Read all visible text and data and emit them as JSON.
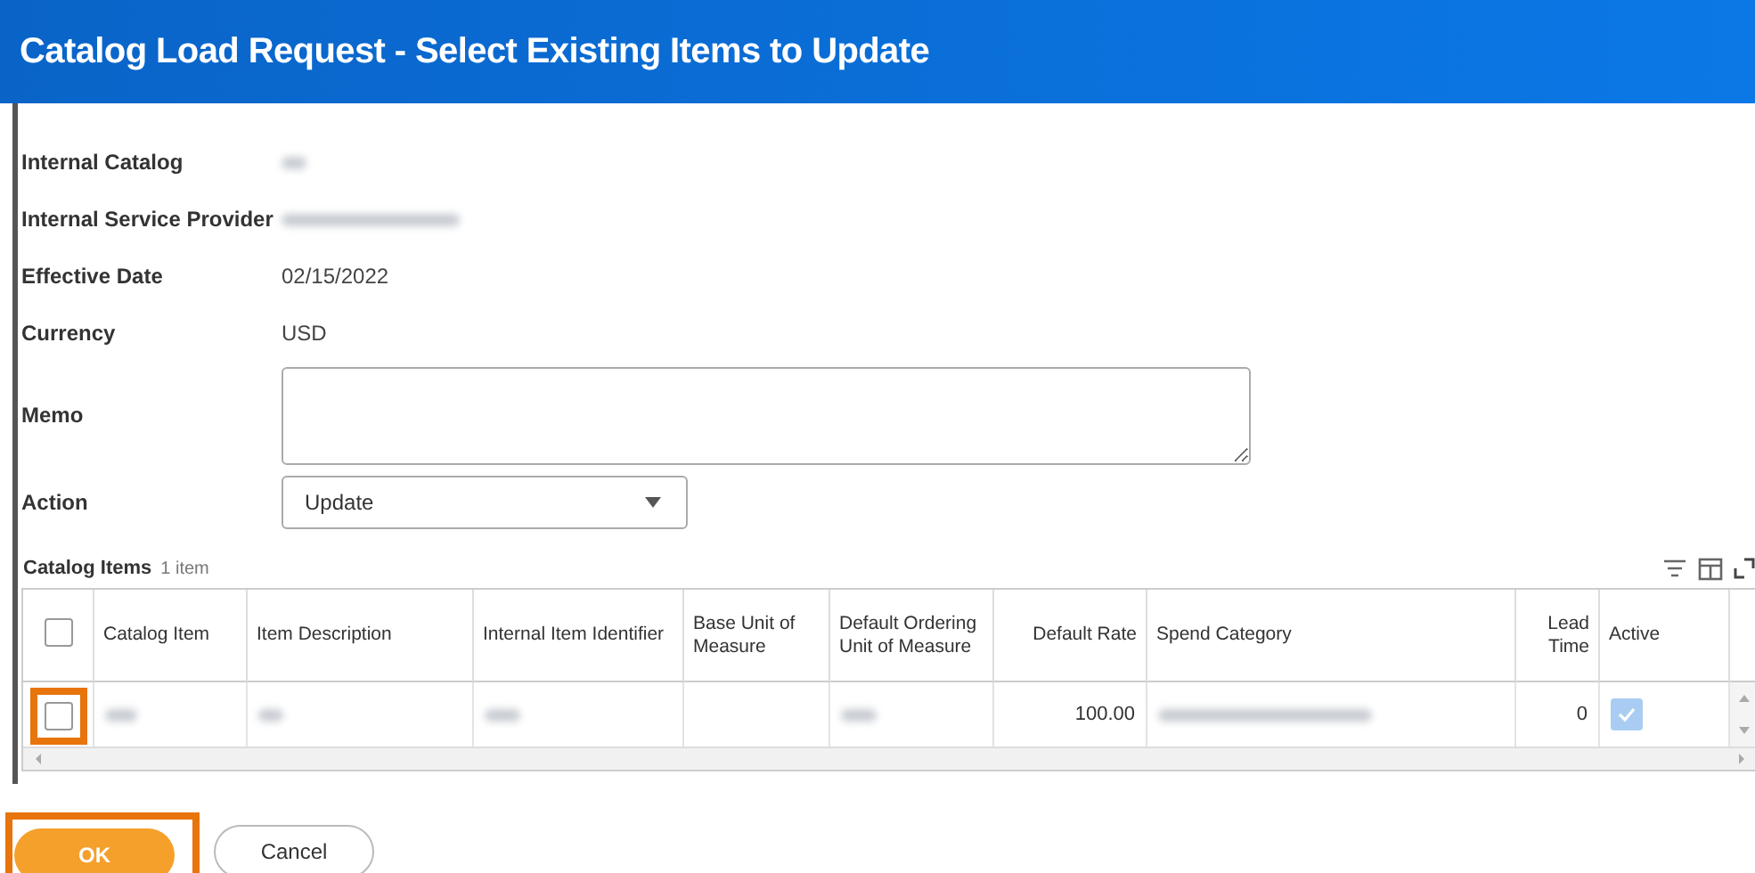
{
  "window": {
    "title": "Catalog Load Request - Select Existing Items to Update"
  },
  "fields": [
    {
      "label": "Internal Catalog",
      "redacted": true,
      "kind": "text"
    },
    {
      "label": "Internal Service Provider",
      "redacted": true,
      "kind": "text"
    },
    {
      "label": "Effective Date",
      "value": "02/15/2022",
      "kind": "text"
    },
    {
      "label": "Currency",
      "value": "USD",
      "kind": "text"
    },
    {
      "label": "Memo",
      "kind": "textarea"
    },
    {
      "label": "Action",
      "value": "Update",
      "kind": "select"
    }
  ],
  "table": {
    "title": "Catalog Items",
    "count": "1 item",
    "columns": [
      {
        "label": "Catalog Item"
      },
      {
        "label": "Item Description"
      },
      {
        "label": "Internal Item Identifier"
      },
      {
        "label": "Base Unit of Measure"
      },
      {
        "label": "Default Ordering Unit of Measure"
      },
      {
        "label": "Default Rate"
      },
      {
        "label": "Spend Category"
      },
      {
        "label": "Lead Time"
      },
      {
        "label": "Active"
      }
    ],
    "header_checked": false,
    "rows": [
      {
        "checked": false,
        "highlight": true,
        "cells": [
          {
            "redacted": true
          },
          {
            "redacted": true
          },
          {
            "redacted": true
          },
          {},
          {
            "redacted": true
          },
          {
            "value": "100.00"
          },
          {
            "redacted": true
          },
          {
            "value": "0"
          },
          {
            "kind": "check",
            "checked": true
          }
        ]
      }
    ]
  },
  "buttons": [
    {
      "label": "OK",
      "kind": "primary",
      "highlight": true
    },
    {
      "label": "Cancel",
      "kind": "secondary",
      "highlight": false
    }
  ]
}
